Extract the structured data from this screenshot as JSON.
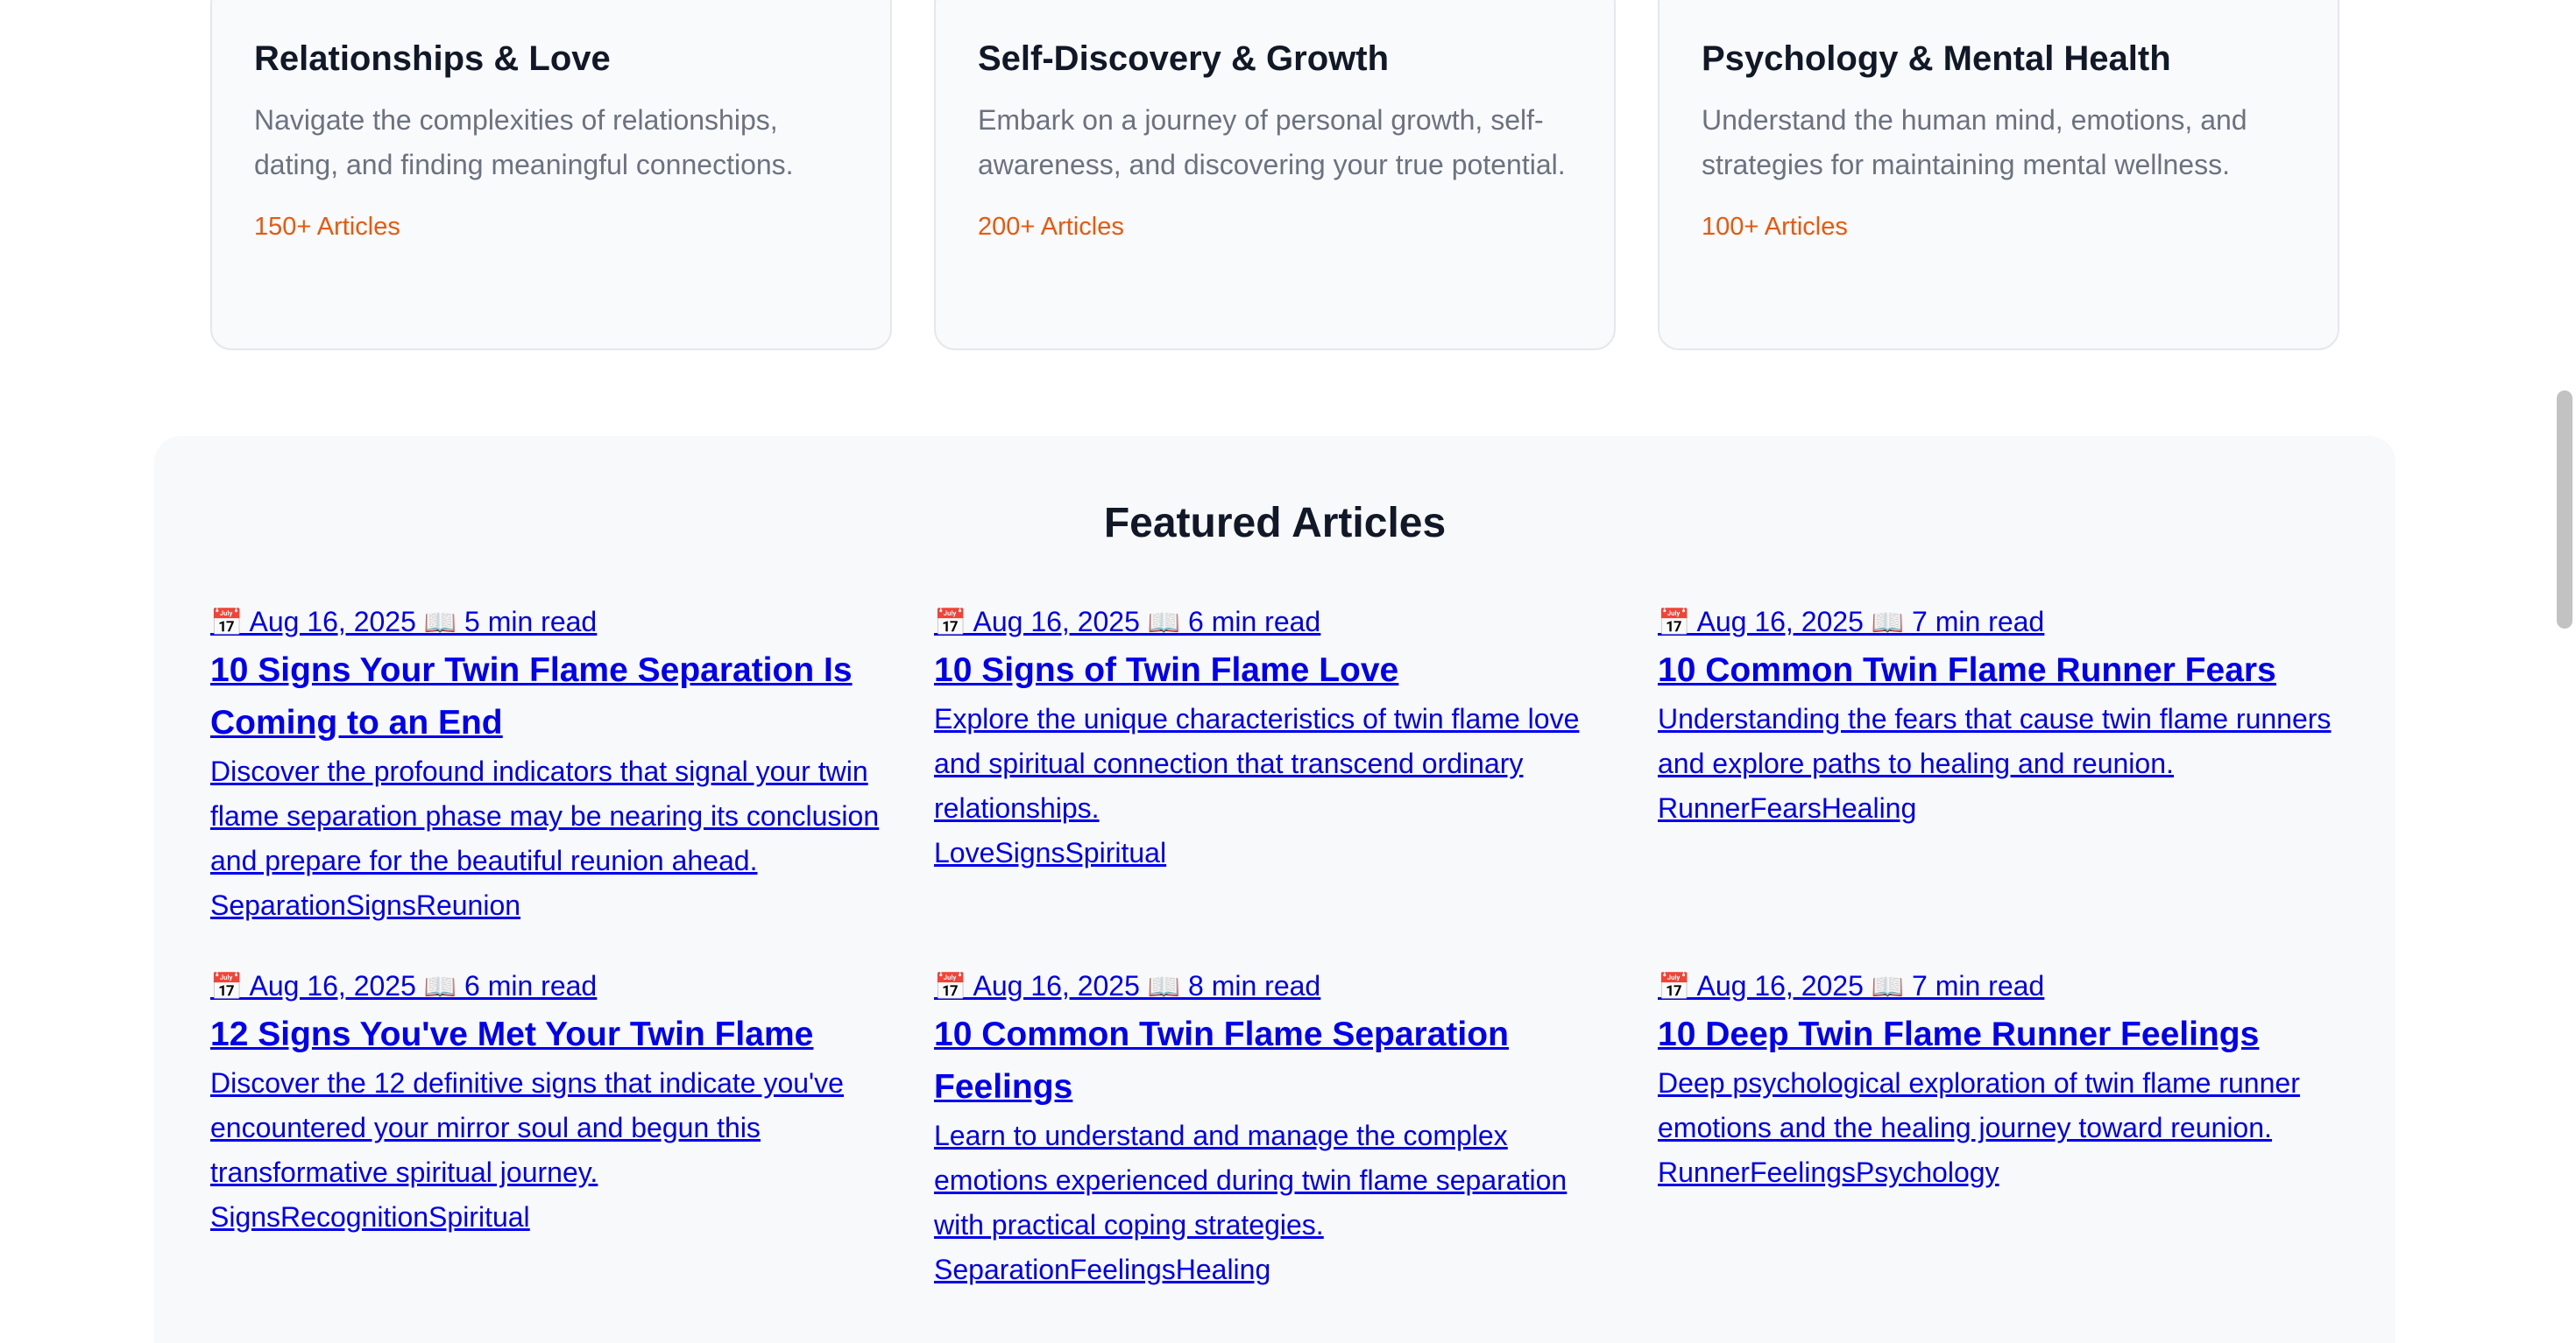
{
  "categories": [
    {
      "title": "Relationships & Love",
      "description": "Navigate the complexities of relationships, dating, and finding meaningful connections.",
      "count": "150+ Articles"
    },
    {
      "title": "Self-Discovery & Growth",
      "description": "Embark on a journey of personal growth, self-awareness, and discovering your true potential.",
      "count": "200+ Articles"
    },
    {
      "title": "Psychology & Mental Health",
      "description": "Understand the human mind, emotions, and strategies for maintaining mental wellness.",
      "count": "100+ Articles"
    }
  ],
  "featured": {
    "heading": "Featured Articles",
    "date_icon": "📅",
    "read_icon": "📖",
    "articles": [
      {
        "date": "Aug 16, 2025",
        "read_time": "5 min read",
        "title": "10 Signs Your Twin Flame Separation Is Coming to an End",
        "excerpt": "Discover the profound indicators that signal your twin flame separation phase may be nearing its conclusion and prepare for the beautiful reunion ahead.",
        "tags": "SeparationSignsReunion"
      },
      {
        "date": "Aug 16, 2025",
        "read_time": "6 min read",
        "title": "10 Signs of Twin Flame Love",
        "excerpt": "Explore the unique characteristics of twin flame love and spiritual connection that transcend ordinary relationships.",
        "tags": "LoveSignsSpiritual"
      },
      {
        "date": "Aug 16, 2025",
        "read_time": "7 min read",
        "title": "10 Common Twin Flame Runner Fears",
        "excerpt": "Understanding the fears that cause twin flame runners and explore paths to healing and reunion.",
        "tags": "RunnerFearsHealing"
      },
      {
        "date": "Aug 16, 2025",
        "read_time": "6 min read",
        "title": "12 Signs You've Met Your Twin Flame",
        "excerpt": "Discover the 12 definitive signs that indicate you've encountered your mirror soul and begun this transformative spiritual journey.",
        "tags": "SignsRecognitionSpiritual"
      },
      {
        "date": "Aug 16, 2025",
        "read_time": "8 min read",
        "title": "10 Common Twin Flame Separation Feelings",
        "excerpt": "Learn to understand and manage the complex emotions experienced during twin flame separation with practical coping strategies.",
        "tags": "SeparationFeelingsHealing"
      },
      {
        "date": "Aug 16, 2025",
        "read_time": "7 min read",
        "title": "10 Deep Twin Flame Runner Feelings",
        "excerpt": "Deep psychological exploration of twin flame runner emotions and the healing journey toward reunion.",
        "tags": "RunnerFeelingsPsychology"
      }
    ]
  }
}
